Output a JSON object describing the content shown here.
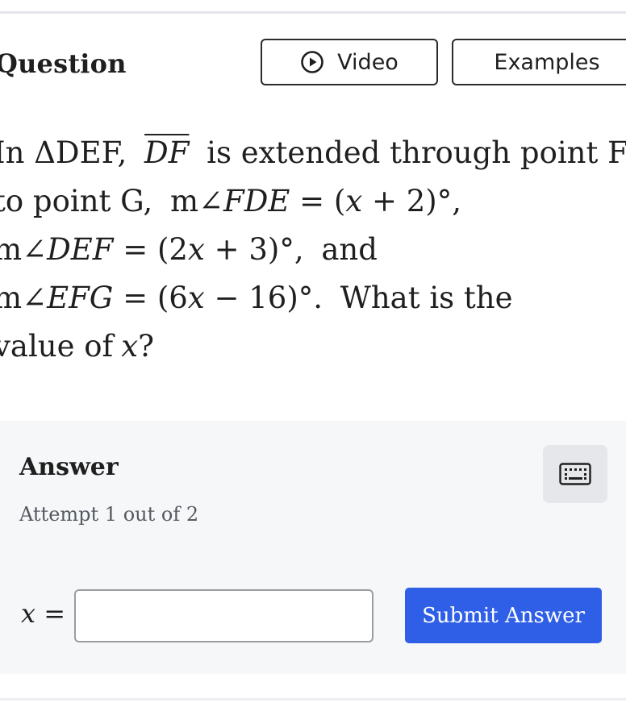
{
  "header": {
    "title": "Question",
    "video_label": "Video",
    "video_icon": "play-circle-icon",
    "examples_label": "Examples"
  },
  "problem": {
    "l1_a": "In ΔDEF,",
    "l1_seg": "DF",
    "l1_b": "is extended through point F",
    "l2_a": "to point G,",
    "l2_m": "m∠",
    "l2_ang": "FDE",
    "l2_eq": " = (",
    "l2_x": "x",
    "l2_rest": " + 2)°,",
    "l3_m": "m∠",
    "l3_ang": "DEF",
    "l3_eq": " = (2",
    "l3_x": "x",
    "l3_rest": " + 3)°,",
    "l3_and": "and",
    "l4_m": "m∠",
    "l4_ang": "EFG",
    "l4_eq": " = (6",
    "l4_x": "x",
    "l4_rest": " − 16)°.",
    "l4_tail": "What is the",
    "l5_a": "value of",
    "l5_x": "x",
    "l5_b": "?"
  },
  "answer": {
    "title": "Answer",
    "attempt": "Attempt 1 out of 2",
    "keyboard_icon": "keyboard-icon",
    "var": "x",
    "eq": " =",
    "input_value": "",
    "submit_label": "Submit Answer"
  },
  "colors": {
    "submit_bg": "#2f5fe6",
    "panel_bg": "#f6f7f9"
  }
}
